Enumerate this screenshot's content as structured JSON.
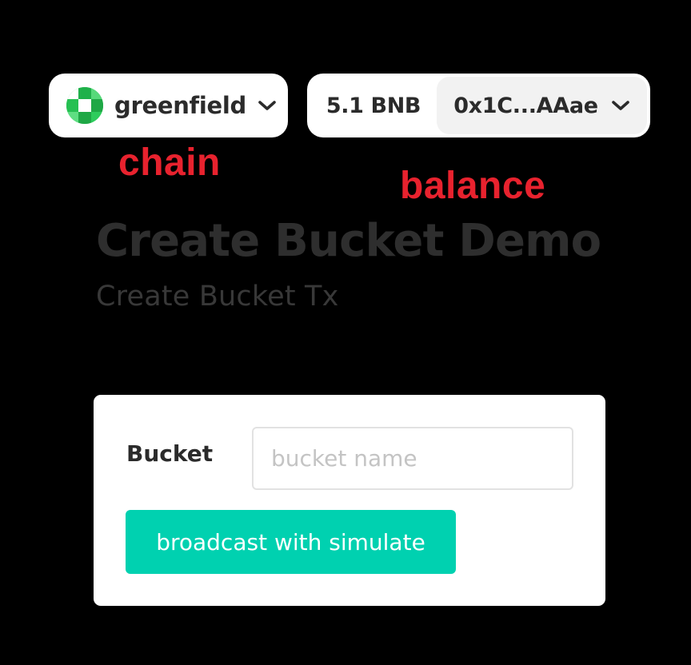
{
  "header": {
    "chain_selector": {
      "name": "greenfield",
      "logo_icon": "greenfield-logo-icon",
      "dropdown_icon": "chevron-down-icon"
    },
    "account": {
      "balance": "5.1 BNB",
      "address": "0x1C...AAae",
      "dropdown_icon": "chevron-down-icon"
    }
  },
  "annotations": {
    "chain": "chain",
    "balance": "balance",
    "color": "#e8222e"
  },
  "page": {
    "title": "Create Bucket Demo",
    "subtitle": "Create Bucket Tx"
  },
  "form": {
    "bucket_label": "Bucket",
    "bucket_input_value": "",
    "bucket_input_placeholder": "bucket name",
    "submit_label": "broadcast with simulate"
  },
  "colors": {
    "background": "#000000",
    "accent": "#00d1b0",
    "logo_green": "#2ecc5c"
  }
}
